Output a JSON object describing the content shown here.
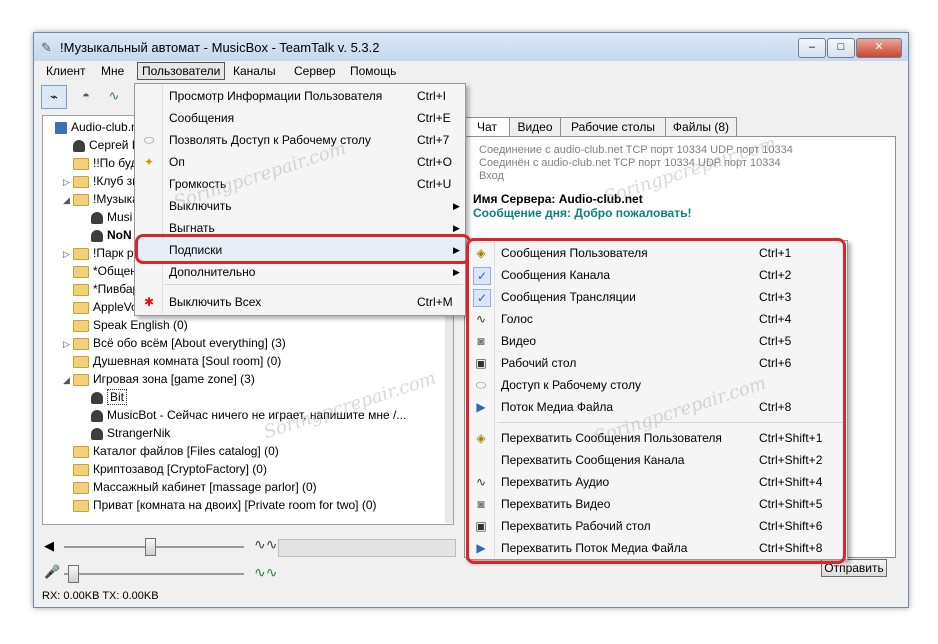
{
  "title": "!Музыкальный автомат - MusicBox - TeamTalk v. 5.3.2",
  "menubar": [
    "Клиент",
    "Мне",
    "Пользователи",
    "Каналы",
    "Сервер",
    "Помощь"
  ],
  "window_buttons": {
    "minimize": "–",
    "maximize": "□",
    "close": "✕"
  },
  "tree": [
    {
      "label": "Audio-club.net",
      "kind": "server"
    },
    {
      "label": "Сергей К",
      "kind": "user"
    },
    {
      "label": "!!По буд",
      "kind": "folder"
    },
    {
      "label": "!Клуб зн",
      "kind": "folder"
    },
    {
      "label": "!Музыка",
      "kind": "folder"
    },
    {
      "label": "Musi",
      "kind": "user"
    },
    {
      "label": "NoN",
      "kind": "user"
    },
    {
      "label": "!Парк ра",
      "kind": "folder"
    },
    {
      "label": "*Общен",
      "kind": "folder"
    },
    {
      "label": "*Пивбар",
      "kind": "folder"
    },
    {
      "label": "AppleVo",
      "kind": "folder"
    },
    {
      "label": "Speak English (0)",
      "kind": "folder"
    },
    {
      "label": "Всё обо всём [About everything] (3)",
      "kind": "folder"
    },
    {
      "label": "Душевная комната [Soul room] (0)",
      "kind": "folder"
    },
    {
      "label": "Игровая зона [game zone] (3)",
      "kind": "folder"
    },
    {
      "label": "Bit",
      "kind": "user"
    },
    {
      "label": "MusicBot - Сейчас ничего не играет, напишите мне /...",
      "kind": "user"
    },
    {
      "label": "StrangerNik",
      "kind": "user"
    },
    {
      "label": "Каталог файлов [Files catalog] (0)",
      "kind": "folder"
    },
    {
      "label": "Криптозавод [CryptoFactory] (0)",
      "kind": "folder"
    },
    {
      "label": "Массажный кабинет [massage parlor] (0)",
      "kind": "folder"
    },
    {
      "label": "Приват [комната на двоих] [Private room for two] (0)",
      "kind": "folder"
    }
  ],
  "tabs": [
    "Чат",
    "Видео",
    "Рабочие столы",
    "Файлы (8)"
  ],
  "chat": {
    "line1": "Соединение с audio-club.net TCP порт 10334 UDP порт 10334",
    "line2": "Соединён с audio-club.net TCP порт 10334 UDP порт 10334",
    "line3": "Вход",
    "server_name": "Имя Сервера: Audio-club.net",
    "motd": "Сообщение дня: Добро пожаловать!"
  },
  "send_label": "Отправить",
  "status": "RX: 0.00KB TX: 0.00KB",
  "users_menu": [
    {
      "label": "Просмотр Информации Пользователя",
      "shortcut": "Ctrl+I",
      "icon": ""
    },
    {
      "label": "Сообщения",
      "shortcut": "Ctrl+E",
      "icon": ""
    },
    {
      "label": "Позволять Доступ к Рабочему столу",
      "shortcut": "Ctrl+7",
      "icon": "eraser-icon"
    },
    {
      "label": "Оп",
      "shortcut": "Ctrl+O",
      "icon": "op-icon"
    },
    {
      "label": "Громкость",
      "shortcut": "Ctrl+U",
      "icon": ""
    },
    {
      "label": "Выключить",
      "shortcut": "",
      "icon": "",
      "submenu": true
    },
    {
      "label": "Выгнать",
      "shortcut": "",
      "icon": "",
      "submenu": true
    },
    {
      "label": "Подписки",
      "shortcut": "",
      "icon": "",
      "submenu": true
    },
    {
      "label": "Дополнительно",
      "shortcut": "",
      "icon": "",
      "submenu": true
    },
    {
      "label": "Выключить Всех",
      "shortcut": "Ctrl+M",
      "icon": "star-icon"
    }
  ],
  "subscriptions_menu": [
    {
      "label": "Сообщения Пользователя",
      "shortcut": "Ctrl+1",
      "icon": "chat-icon"
    },
    {
      "label": "Сообщения Канала",
      "shortcut": "Ctrl+2",
      "icon": "check-icon"
    },
    {
      "label": "Сообщения Трансляции",
      "shortcut": "Ctrl+3",
      "icon": "check-icon"
    },
    {
      "label": "Голос",
      "shortcut": "Ctrl+4",
      "icon": "wave-icon"
    },
    {
      "label": "Видео",
      "shortcut": "Ctrl+5",
      "icon": "camera-icon"
    },
    {
      "label": "Рабочий стол",
      "shortcut": "Ctrl+6",
      "icon": "monitor-icon"
    },
    {
      "label": "Доступ к Рабочему столу",
      "shortcut": "",
      "icon": "eraser-icon"
    },
    {
      "label": "Поток Медиа Файла",
      "shortcut": "Ctrl+8",
      "icon": "media-icon"
    },
    {
      "label": "Перехватить Сообщения Пользователя",
      "shortcut": "Ctrl+Shift+1",
      "icon": "chat-icon"
    },
    {
      "label": "Перехватить Сообщения Канала",
      "shortcut": "Ctrl+Shift+2",
      "icon": ""
    },
    {
      "label": "Перехватить Аудио",
      "shortcut": "Ctrl+Shift+4",
      "icon": "wave-icon"
    },
    {
      "label": "Перехватить Видео",
      "shortcut": "Ctrl+Shift+5",
      "icon": "camera-icon"
    },
    {
      "label": "Перехватить Рабочий стол",
      "shortcut": "Ctrl+Shift+6",
      "icon": "monitor-icon"
    },
    {
      "label": "Перехватить Поток Медиа Файла",
      "shortcut": "Ctrl+Shift+8",
      "icon": "media-icon"
    }
  ],
  "watermark": "Soringpcrepair.com"
}
